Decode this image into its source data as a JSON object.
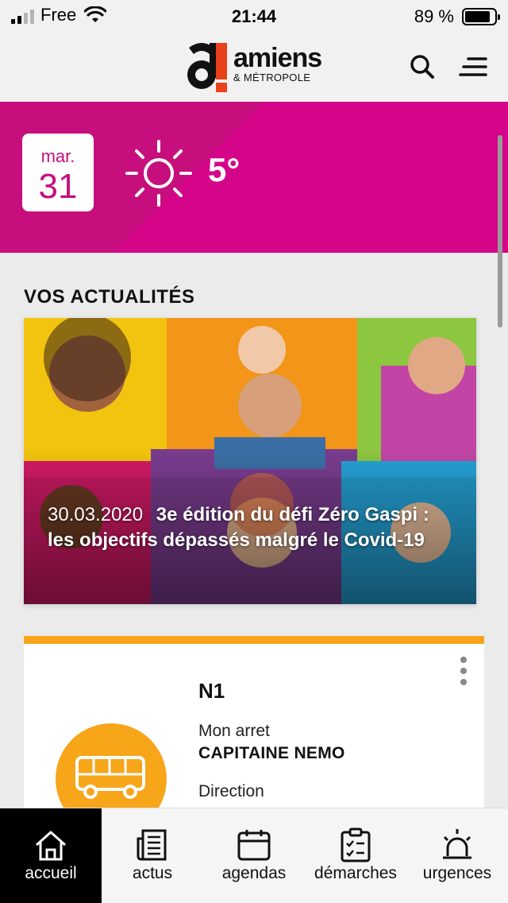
{
  "status_bar": {
    "carrier": "Free",
    "time": "21:44",
    "battery": "89 %"
  },
  "header": {
    "logo_text": "amiens",
    "logo_sub": "& MÉTROPOLE",
    "search_icon": "search-icon",
    "menu_icon": "menu-icon"
  },
  "weather": {
    "day": "mar.",
    "date": "31",
    "temperature": "5°",
    "icon": "sun-icon"
  },
  "news": {
    "section_title": "VOS ACTUALITÉS",
    "date": "30.03.2020",
    "title": "3e édition du défi Zéro Gaspi : les objectifs dépassés malgré le Covid-19"
  },
  "transport": {
    "line": "N1",
    "stop_label": "Mon arret",
    "stop_name": "CAPITAINE NEMO",
    "direction_label": "Direction",
    "icon": "bus-icon",
    "accent_color": "#f7a519"
  },
  "tabs": [
    {
      "label": "accueil",
      "icon": "home-icon",
      "active": true
    },
    {
      "label": "actus",
      "icon": "newspaper-icon",
      "active": false
    },
    {
      "label": "agendas",
      "icon": "calendar-icon",
      "active": false
    },
    {
      "label": "démarches",
      "icon": "checklist-icon",
      "active": false
    },
    {
      "label": "urgences",
      "icon": "alarm-icon",
      "active": false
    }
  ],
  "colors": {
    "brand_pink": "#c60f7d",
    "accent_orange": "#f7a519"
  }
}
